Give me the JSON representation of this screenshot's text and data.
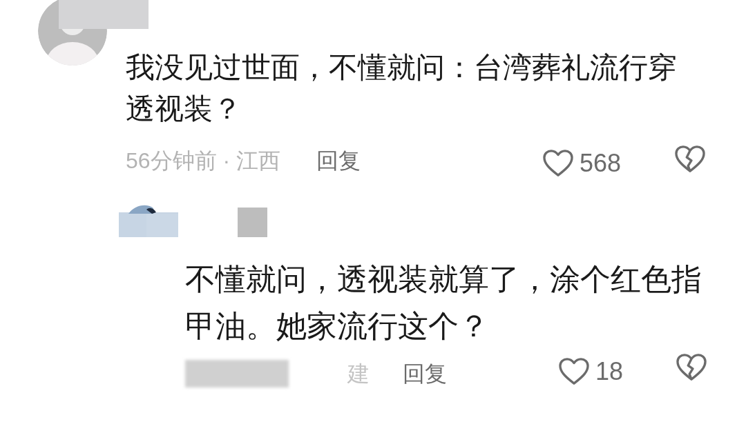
{
  "comments": [
    {
      "avatar": {
        "kind": "silhouette"
      },
      "text": "我没见过世面，不懂就问：台湾葬礼流行穿透视装？",
      "time": "56分钟前 · 江西",
      "reply": "回复",
      "likes": "568",
      "replies": [
        {
          "text": "不懂就问，透视装就算了，涂个红色指甲油。她家流行这个？",
          "location": "建",
          "reply": "回复",
          "likes": "18"
        }
      ]
    }
  ]
}
